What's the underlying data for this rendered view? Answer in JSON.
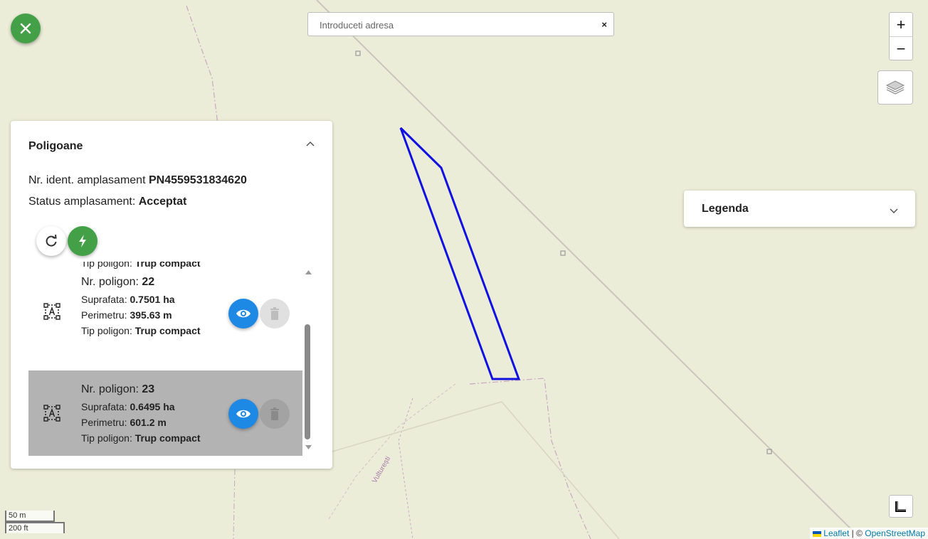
{
  "search": {
    "placeholder": "Introduceti adresa",
    "clear": "×"
  },
  "zoom": {
    "in": "+",
    "out": "−"
  },
  "map": {
    "village_label": "Vulturești",
    "polygon_color": "#1010e0"
  },
  "panel": {
    "title": "Poligoane",
    "ident_label": "Nr. ident. amplasament ",
    "ident_value": "PN4559531834620",
    "status_label": "Status amplasament: ",
    "status_value": "Acceptat",
    "items": [
      {
        "nr_label": "Nr. poligon: ",
        "nr": "",
        "suprafata_label": "Suprafata: ",
        "suprafata": "",
        "perimetru_label": "Perimetru: ",
        "perimetru": "",
        "tip_label": "Tip poligon: ",
        "tip": "Trup compact"
      },
      {
        "nr_label": "Nr. poligon: ",
        "nr": "22",
        "suprafata_label": "Suprafata: ",
        "suprafata": "0.7501 ha",
        "perimetru_label": "Perimetru: ",
        "perimetru": "395.63 m",
        "tip_label": "Tip poligon: ",
        "tip": "Trup compact"
      },
      {
        "nr_label": "Nr. poligon: ",
        "nr": "23",
        "suprafata_label": "Suprafata: ",
        "suprafata": "0.6495 ha",
        "perimetru_label": "Perimetru: ",
        "perimetru": "601.2 m",
        "tip_label": "Tip poligon: ",
        "tip": "Trup compact"
      }
    ]
  },
  "legend": {
    "title": "Legenda"
  },
  "scale": {
    "metric": "50 m",
    "imperial": "200 ft"
  },
  "attribution": {
    "leaflet": "Leaflet",
    "separator": " | © ",
    "osm": "OpenStreetMap"
  },
  "colors": {
    "accent_green": "#43a047",
    "accent_blue": "#1e88e5",
    "selected_row": "#b3b3b3",
    "map_bg": "#ecedd8"
  }
}
